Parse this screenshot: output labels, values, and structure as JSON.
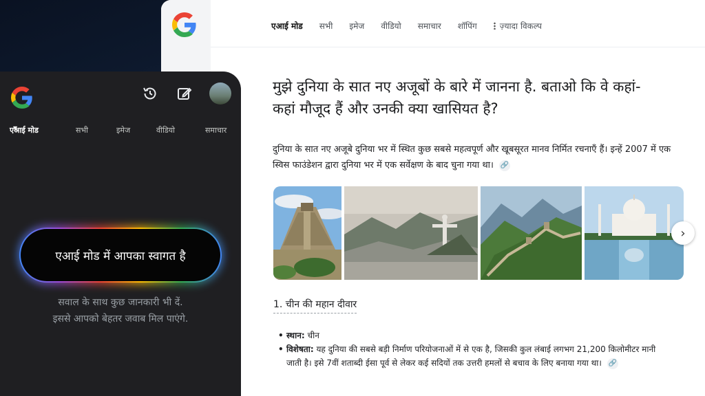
{
  "desktop": {
    "tabs": [
      {
        "label": "एआई मोड",
        "active": true
      },
      {
        "label": "सभी"
      },
      {
        "label": "इमेज"
      },
      {
        "label": "वीडियो"
      },
      {
        "label": "समाचार"
      },
      {
        "label": "शॉपिंग"
      }
    ],
    "more_label": "ज़्यादा विकल्प",
    "question": "मुझे दुनिया के सात नए अजूबों के बारे में जानना है. बताओ कि वे कहां-कहां मौजूद हैं और उनकी क्या खासियत है?",
    "answer": "दुनिया के सात नए अजूबे दुनिया भर में स्थित कुछ सबसे महत्वपूर्ण और खूबसूरत मानव निर्मित रचनाएँ हैं। इन्हें 2007 में एक स्विस फाउंडेशन द्वारा दुनिया भर में एक सर्वेक्षण के बाद चुना गया था।",
    "images": [
      "chichen-itza",
      "christ-the-redeemer",
      "great-wall-of-china",
      "taj-mahal"
    ],
    "section_heading": "1. चीन की महान दीवार",
    "bullets": {
      "location_label": "स्थान:",
      "location_value": "चीन",
      "feature_label": "विशेषता:",
      "feature_value": "यह दुनिया की सबसे बड़ी निर्माण परियोजनाओं में से एक है, जिसकी कुल लंबाई लगभग 21,200 किलोमीटर मानी जाती है। इसे 7वीं शताब्दी ईसा पूर्व से लेकर कई सदियों तक उत्तरी हमलों से बचाव के लिए बनाया गया था।"
    }
  },
  "mobile": {
    "tabs": [
      {
        "label": "एआई मोड",
        "active": true
      },
      {
        "label": "सभी"
      },
      {
        "label": "इमेज"
      },
      {
        "label": "वीडियो"
      },
      {
        "label": "समाचार"
      }
    ],
    "welcome": "एआई मोड में आपका स्वागत है",
    "sub_line1": "सवाल के साथ कुछ जानकारी भी दें.",
    "sub_line2": "इससे आपको बेहतर जवाब मिल पाएंगे."
  },
  "colors": {
    "google_blue": "#4285f4",
    "google_red": "#ea4335",
    "google_yellow": "#fbbc05",
    "google_green": "#34a853",
    "mobile_bg": "#1f1f22"
  },
  "icons": [
    "google-logo",
    "history-icon",
    "edit-icon",
    "avatar",
    "link-icon",
    "chevron-right-icon",
    "more-vert-icon",
    "caret-down-icon"
  ]
}
